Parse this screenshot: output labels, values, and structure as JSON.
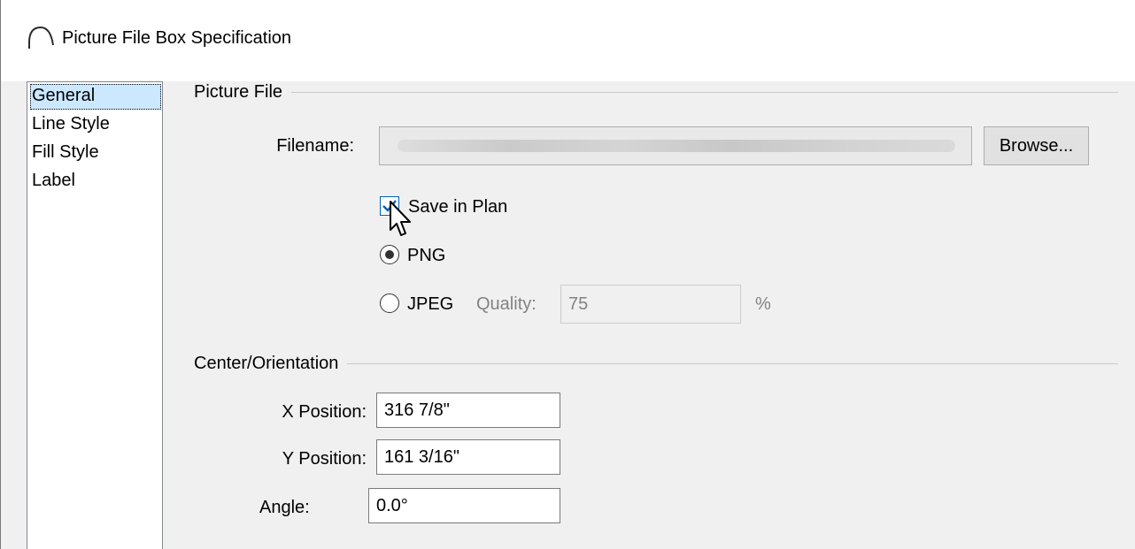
{
  "window": {
    "title": "Picture File Box Specification"
  },
  "nav": {
    "items": [
      {
        "label": "General",
        "selected": true
      },
      {
        "label": "Line Style",
        "selected": false
      },
      {
        "label": "Fill Style",
        "selected": false
      },
      {
        "label": "Label",
        "selected": false
      }
    ]
  },
  "picture_file": {
    "group_label": "Picture File",
    "filename_label": "Filename:",
    "filename_value": "",
    "browse_label": "Browse...",
    "save_in_plan_label": "Save in Plan",
    "save_in_plan_checked": true,
    "png_label": "PNG",
    "png_selected": true,
    "jpeg_label": "JPEG",
    "jpeg_selected": false,
    "quality_label": "Quality:",
    "quality_value": "75",
    "quality_unit": "%"
  },
  "center_orientation": {
    "group_label": "Center/Orientation",
    "x_label": "X Position:",
    "x_value": "316 7/8\"",
    "y_label": "Y Position:",
    "y_value": "161 3/16\"",
    "angle_label": "Angle:",
    "angle_value": "0.0°"
  },
  "colors": {
    "selection": "#cce8ff",
    "checkbox_accent": "#005fb8",
    "disabled_text": "#838383"
  }
}
